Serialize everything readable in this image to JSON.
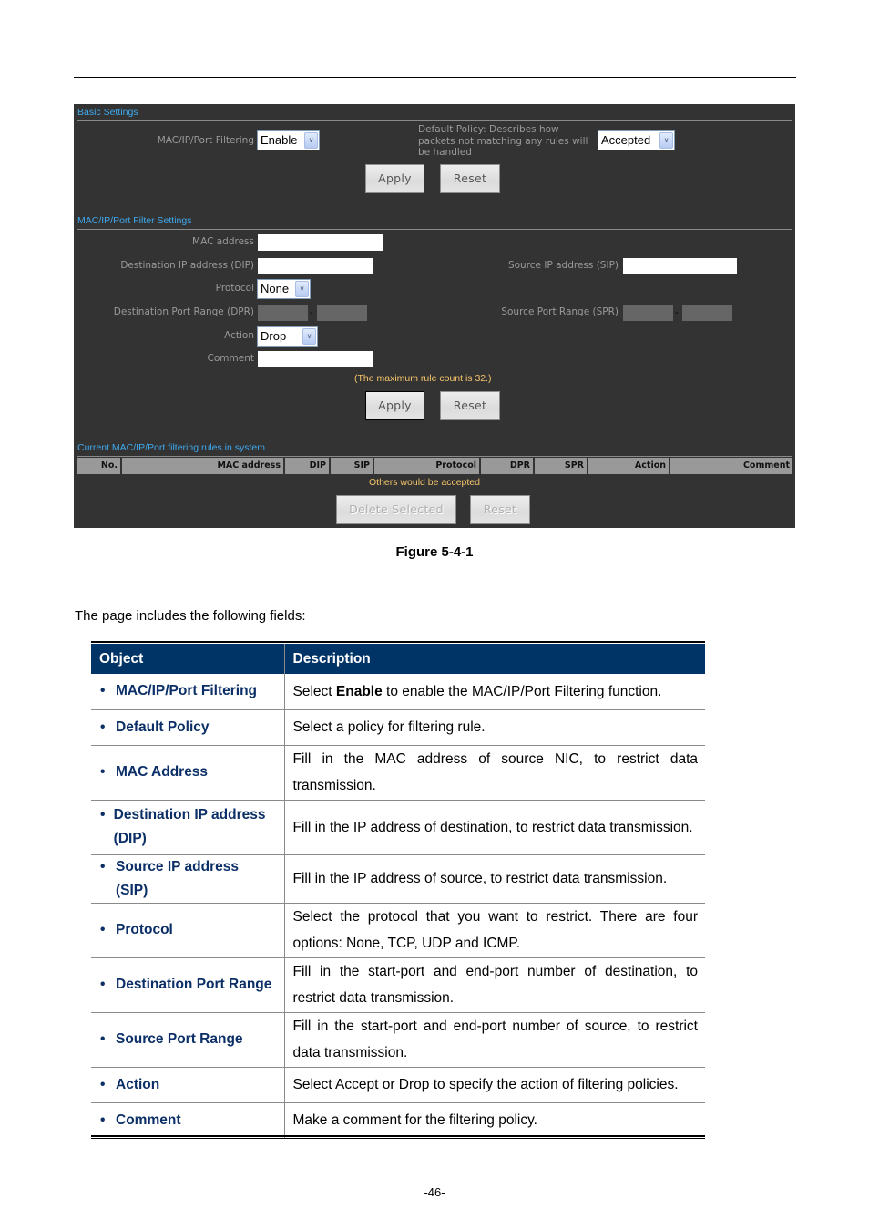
{
  "figure": {
    "basic_settings": {
      "title": "Basic Settings",
      "filtering_label": "MAC/IP/Port Filtering",
      "filtering_value": "Enable",
      "policy_label_lines": [
        "Default Policy: Describes how",
        "packets not matching any rules will",
        "be handled"
      ],
      "policy_value": "Accepted",
      "apply_label": "Apply",
      "reset_label": "Reset"
    },
    "filter_settings": {
      "title": "MAC/IP/Port Filter Settings",
      "mac_label": "MAC address",
      "mac_value": "",
      "dip_label": "Destination IP address (DIP)",
      "dip_value": "",
      "sip_label": "Source IP address (SIP)",
      "sip_value": "",
      "protocol_label": "Protocol",
      "protocol_value": "None",
      "dpr_label": "Destination Port Range (DPR)",
      "spr_label": "Source Port Range (SPR)",
      "range_sep": "-",
      "action_label": "Action",
      "action_value": "Drop",
      "comment_label": "Comment",
      "comment_value": "",
      "max_note": "(The maximum rule count is 32.)",
      "apply_label": "Apply",
      "reset_label": "Reset"
    },
    "current_rules": {
      "title": "Current MAC/IP/Port filtering rules in system",
      "columns": [
        "No.",
        "MAC address",
        "DIP",
        "SIP",
        "Protocol",
        "DPR",
        "SPR",
        "Action",
        "Comment"
      ],
      "others_note": "Others would be accepted",
      "delete_label": "Delete Selected",
      "reset_label": "Reset"
    }
  },
  "caption": "Figure 5-4-1",
  "intro": "The page includes the following fields:",
  "table": {
    "headers": [
      "Object",
      "Description"
    ],
    "rows": [
      {
        "object": "MAC/IP/Port Filtering",
        "desc_pre": "Select ",
        "desc_bold": "Enable",
        "desc_post": " to enable the MAC/IP/Port Filtering function."
      },
      {
        "object": "Default Policy",
        "desc": "Select a policy for filtering rule."
      },
      {
        "object": "MAC Address",
        "desc": "Fill in the MAC address of source NIC, to restrict data transmission."
      },
      {
        "object": "Destination IP address (DIP)",
        "desc": "Fill in the IP address of destination, to restrict data transmission."
      },
      {
        "object": "Source IP address (SIP)",
        "desc": "Fill in the IP address of source, to restrict data transmission."
      },
      {
        "object": "Protocol",
        "desc": "Select the protocol that you want to restrict. There are four options: None, TCP, UDP and ICMP."
      },
      {
        "object": "Destination Port Range",
        "desc": "Fill in the start-port and end-port number of destination, to restrict data transmission."
      },
      {
        "object": "Source Port Range",
        "desc": "Fill in the start-port and end-port number of source, to restrict data transmission."
      },
      {
        "object": "Action",
        "desc": "Select Accept or Drop to specify the action of filtering policies."
      },
      {
        "object": "Comment",
        "desc": "Make a comment for the filtering policy."
      }
    ]
  },
  "page_number": "-46-"
}
